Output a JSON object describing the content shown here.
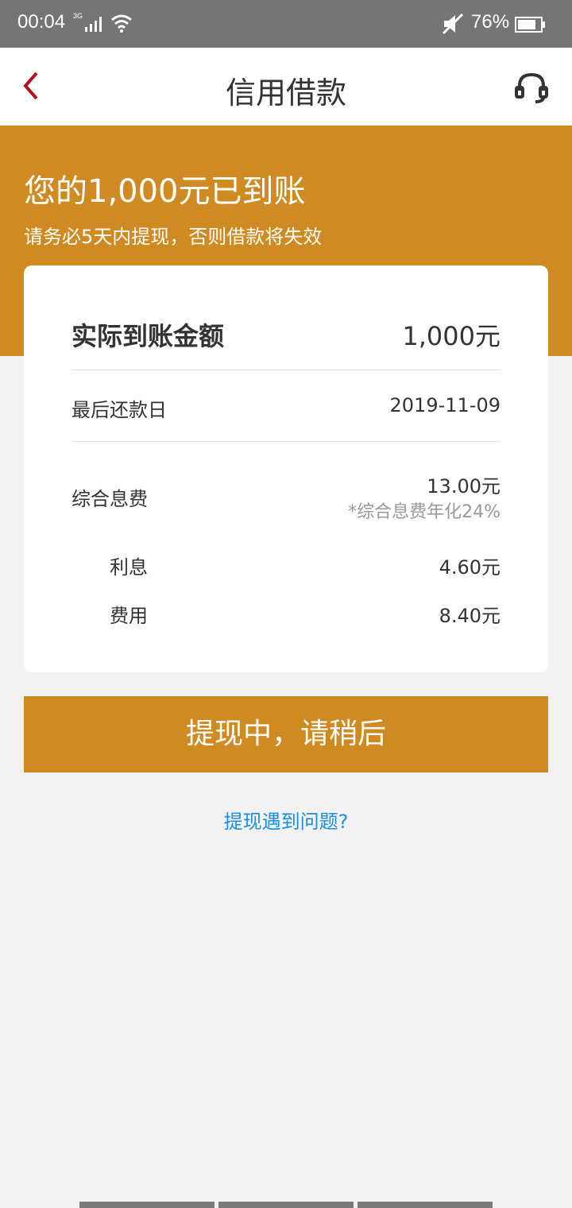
{
  "status_bar": {
    "time": "00:04",
    "network": "3G",
    "battery": "76%",
    "icons": [
      "signal-icon",
      "wifi-icon",
      "mute-icon",
      "battery-icon"
    ]
  },
  "nav": {
    "title": "信用借款",
    "back_icon": "back-chevron-icon",
    "service_icon": "headset-icon",
    "accent_color": "#b3121f"
  },
  "banner": {
    "title": "您的1,000元已到账",
    "subtitle": "请务必5天内提现，否则借款将失效",
    "color": "#d08a22"
  },
  "card": {
    "actual_amount_label": "实际到账金额",
    "actual_amount_value": "1,000元",
    "due_date_label": "最后还款日",
    "due_date_value": "2019-11-09",
    "total_fee_label": "综合息费",
    "total_fee_value": "13.00元",
    "total_fee_note": "*综合息费年化24%",
    "interest_label": "利息",
    "interest_value": "4.60元",
    "fee_label": "费用",
    "fee_value": "8.40元"
  },
  "action_button": {
    "label": "提现中，请稍后"
  },
  "help_link": {
    "label": "提现遇到问题?",
    "color": "#1a8fe0"
  }
}
